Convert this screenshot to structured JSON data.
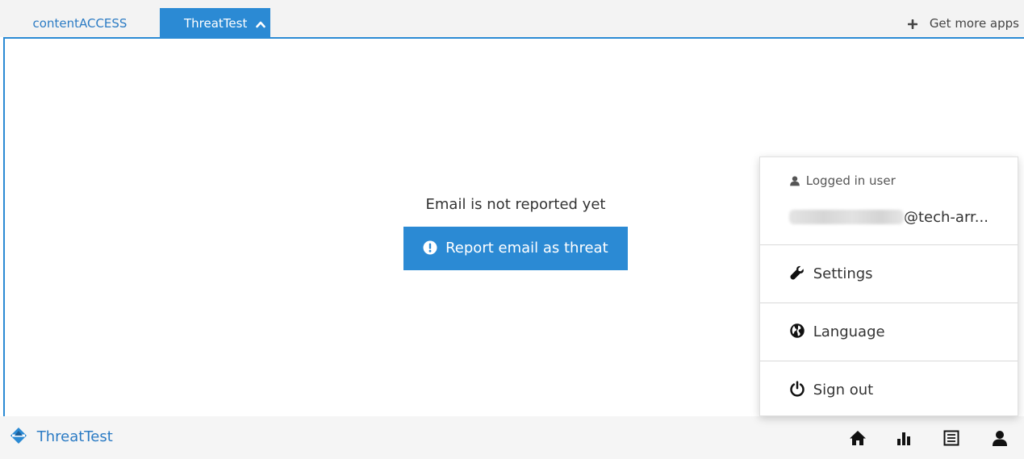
{
  "tabs": [
    {
      "label": "contentACCESS"
    },
    {
      "label": "ThreatTest"
    }
  ],
  "more_apps_label": "Get more apps",
  "main": {
    "status_text": "Email is not reported yet",
    "report_button_label": "Report email as threat"
  },
  "footer": {
    "brand": "ThreatTest",
    "icons": [
      "home-icon",
      "bar-chart-icon",
      "list-icon",
      "user-icon"
    ]
  },
  "user_menu": {
    "logged_in_label": "Logged in user",
    "email_domain": "@tech-arr...",
    "items": [
      {
        "label": "Settings",
        "icon": "wrench-icon"
      },
      {
        "label": "Language",
        "icon": "globe-icon"
      },
      {
        "label": "Sign out",
        "icon": "power-icon"
      }
    ]
  },
  "colors": {
    "accent": "#2b8ad4",
    "link": "#2b7bc4",
    "footer_bg": "#f5f5f5",
    "tabbar_bg": "#f3f3f3"
  }
}
